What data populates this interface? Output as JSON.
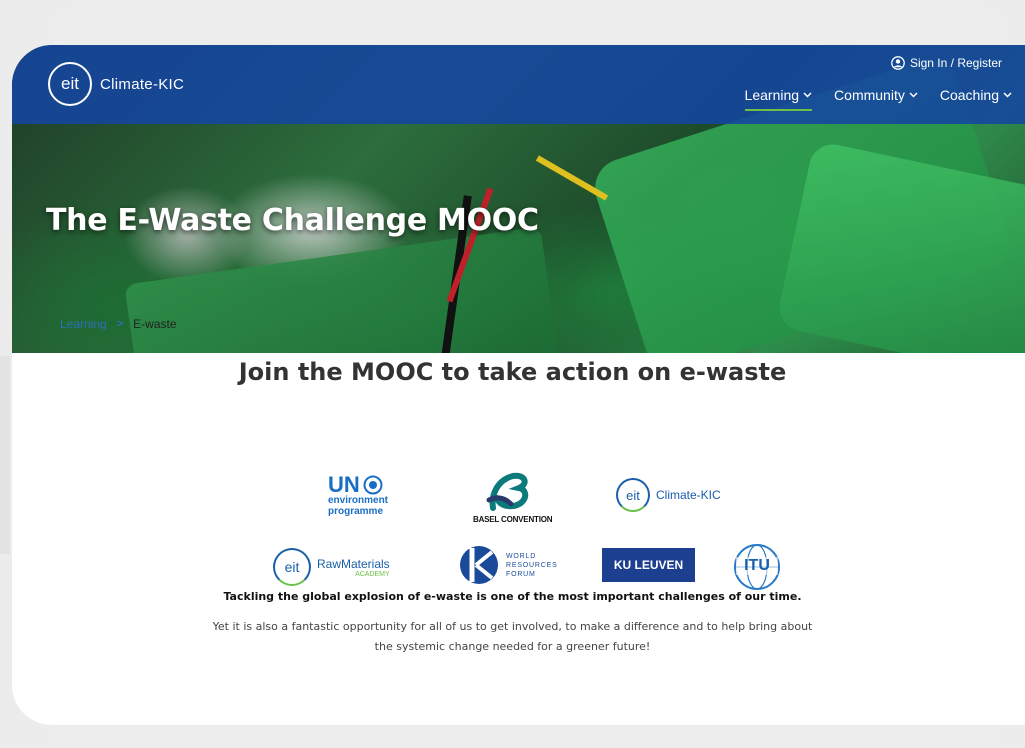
{
  "brand": {
    "logo_mark": "eit",
    "logo_name": "Climate-KIC"
  },
  "header": {
    "signin_label": "Sign In / Register",
    "nav": [
      {
        "label": "Learning",
        "active": true
      },
      {
        "label": "Community",
        "active": false
      },
      {
        "label": "Coaching",
        "active": false
      }
    ]
  },
  "hero": {
    "title": "The E-Waste Challenge MOOC"
  },
  "breadcrumb": {
    "parent": "Learning",
    "separator": ">",
    "current": "E-waste"
  },
  "main": {
    "heading": "Join the MOOC to take action on e-waste",
    "tagline": "Tackling the global explosion of e-waste is one of the most important challenges of our time.",
    "description": "Yet it is also a fantastic opportunity for all of us to get involved, to make a difference and to help bring about the systemic change needed for a greener future!"
  },
  "partners": {
    "unep": {
      "line1": "UN",
      "line2": "environment",
      "line3": "programme"
    },
    "basel": {
      "text": "BASEL CONVENTION"
    },
    "eit_climate": {
      "mark": "eit",
      "name": "Climate-KIC"
    },
    "eit_raw": {
      "mark": "eit",
      "name": "RawMaterials",
      "sub": "ACADEMY"
    },
    "wrf": {
      "line1": "WORLD",
      "line2": "RESOURCES",
      "line3": "FORUM"
    },
    "kul": {
      "text": "KU LEUVEN"
    },
    "itu": {
      "text": "ITU"
    }
  },
  "colors": {
    "nav_bg": "#1446a0",
    "accent_green": "#6cc04a",
    "link": "#2a6fb7"
  }
}
